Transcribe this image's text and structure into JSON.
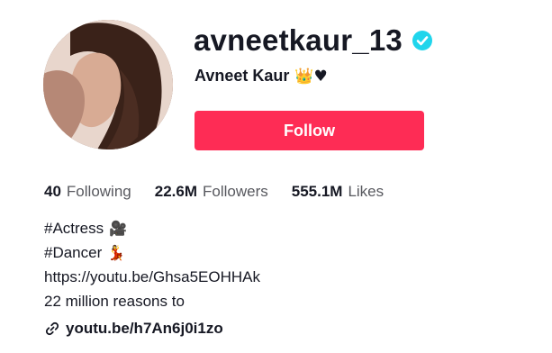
{
  "profile": {
    "username": "avneetkaur_13",
    "display_name": "Avneet Kaur",
    "display_emojis": "👑♥",
    "verified": true,
    "accent_color": "#fe2c55",
    "verified_color": "#20d5ec"
  },
  "actions": {
    "follow_label": "Follow"
  },
  "stats": {
    "following_count": "40",
    "following_label": "Following",
    "followers_count": "22.6M",
    "followers_label": "Followers",
    "likes_count": "555.1M",
    "likes_label": "Likes"
  },
  "bio": {
    "line1_text": "#Actress",
    "line1_emoji": "🎥",
    "line2_text": "#Dancer",
    "line2_emoji": "💃",
    "line3_text": "https://youtu.be/Ghsa5EOHHAk",
    "line4_text": "22 million reasons to"
  },
  "link": {
    "icon": "link-icon",
    "text": "youtu.be/h7An6j0i1zo"
  }
}
